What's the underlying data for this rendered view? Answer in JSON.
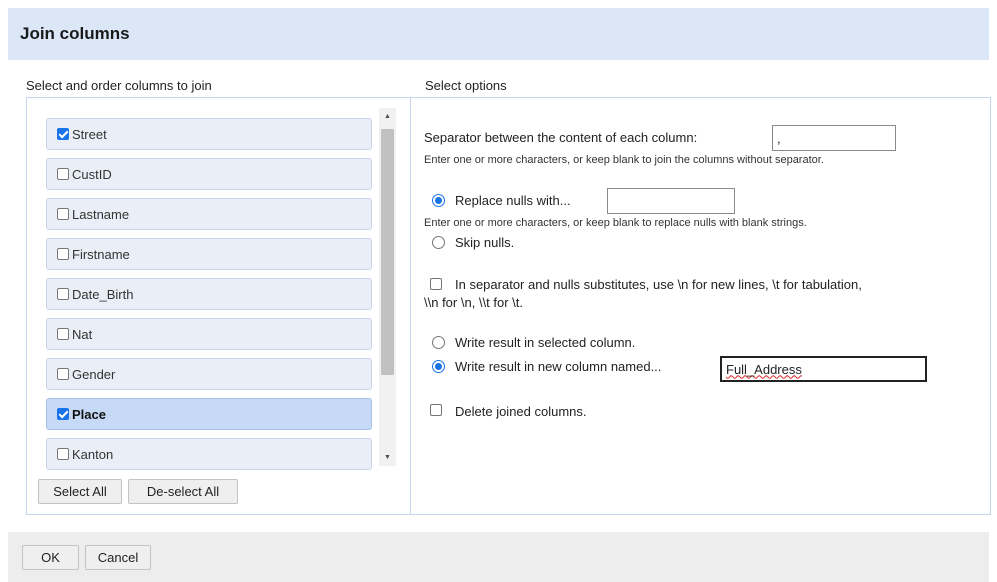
{
  "dialog": {
    "title": "Join columns"
  },
  "left": {
    "label": "Select and order columns to join",
    "columns": [
      {
        "name": "Street",
        "checked": true,
        "selected": false
      },
      {
        "name": "CustID",
        "checked": false,
        "selected": false
      },
      {
        "name": "Lastname",
        "checked": false,
        "selected": false
      },
      {
        "name": "Firstname",
        "checked": false,
        "selected": false
      },
      {
        "name": "Date_Birth",
        "checked": false,
        "selected": false
      },
      {
        "name": "Nat",
        "checked": false,
        "selected": false
      },
      {
        "name": "Gender",
        "checked": false,
        "selected": false
      },
      {
        "name": "Place",
        "checked": true,
        "selected": true
      },
      {
        "name": "Kanton",
        "checked": false,
        "selected": false
      }
    ],
    "select_all": "Select All",
    "deselect_all": "De-select All"
  },
  "right": {
    "label": "Select options",
    "separator_label": "Separator between the content of each column:",
    "separator_value": ",",
    "separator_help": "Enter one or more characters, or keep blank to join the columns without separator.",
    "replace_nulls_label": "Replace nulls with...",
    "replace_nulls_value": "",
    "replace_nulls_help": "Enter one or more characters, or keep blank to replace nulls with blank strings.",
    "skip_nulls_label": "Skip nulls.",
    "escape_label_1": "In separator and nulls substitutes, use \\n for new lines, \\t for tabulation,",
    "escape_label_2": "\\\\n for \\n, \\\\t for \\t.",
    "write_selected_label": "Write result in selected column.",
    "write_new_label": "Write result in new column named...",
    "new_column_value": "Full_Address",
    "delete_label": "Delete joined columns."
  },
  "footer": {
    "ok": "OK",
    "cancel": "Cancel"
  },
  "colors": {
    "header_bg": "#dbe7f7",
    "accent": "#1a73e8",
    "selected_item_bg": "#c6d9f7"
  }
}
